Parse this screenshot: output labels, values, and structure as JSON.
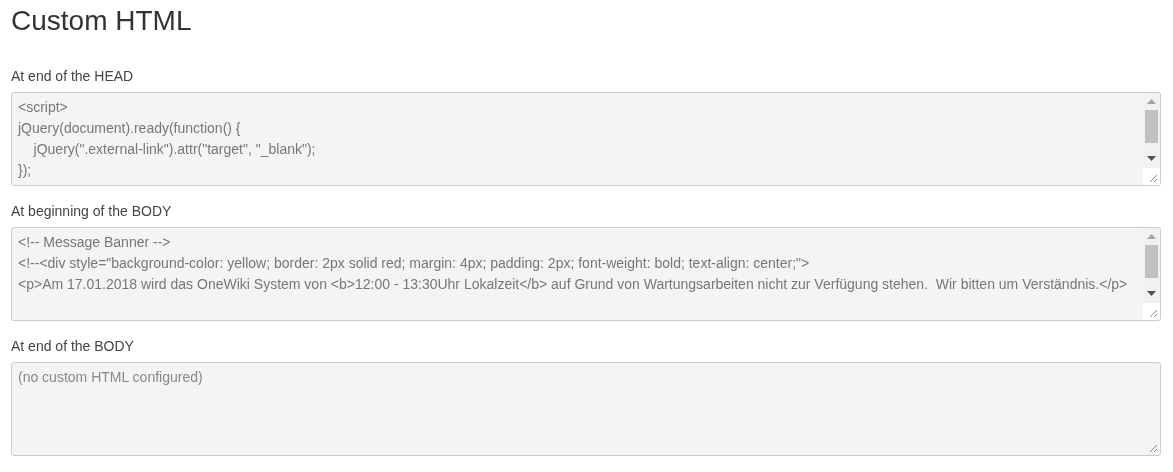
{
  "title": "Custom HTML",
  "fields": [
    {
      "label": "At end of the HEAD",
      "lines": [
        "<script>",
        "jQuery(document).ready(function() {",
        "    jQuery(\".external-link\").attr(\"target\", \"_blank\");",
        "});"
      ]
    },
    {
      "label": "At beginning of the BODY",
      "lines": [
        "<!-- Message Banner -->",
        "<!--<div style=\"background-color: yellow; border: 2px solid red; margin: 4px; padding: 2px; font-weight: bold; text-align: center;\">",
        "<p>Am 17.01.2018 wird das OneWiki System von <b>12:00 - 13:30Uhr Lokalzeit</b> auf Grund von Wartungsarbeiten nicht zur Verfügung stehen.  Wir bitten um Verständnis.</p>"
      ]
    },
    {
      "label": "At end of the BODY",
      "placeholder": "(no custom HTML configured)"
    }
  ]
}
